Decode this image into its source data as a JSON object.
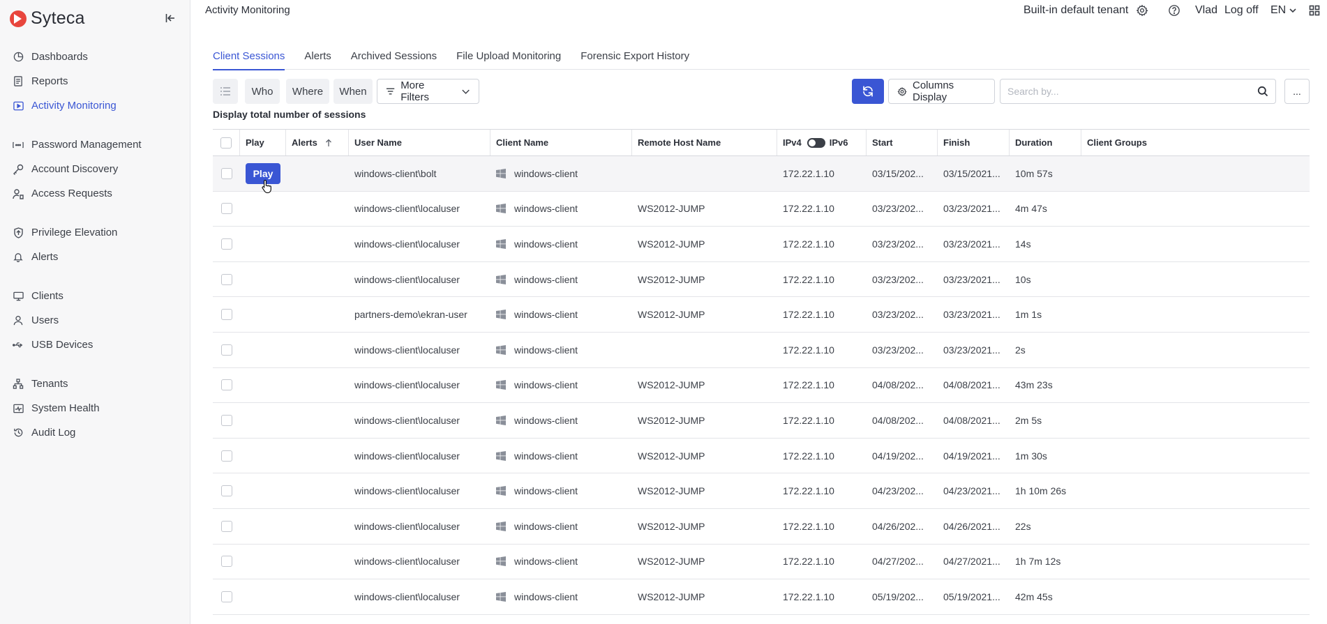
{
  "brand": {
    "name": "Syteca"
  },
  "sidebar": {
    "groups": [
      [
        {
          "label": "Dashboards",
          "icon": "dashboard-icon",
          "active": false
        },
        {
          "label": "Reports",
          "icon": "report-icon",
          "active": false
        },
        {
          "label": "Activity Monitoring",
          "icon": "play-screen-icon",
          "active": true
        }
      ],
      [
        {
          "label": "Password Management",
          "icon": "password-icon",
          "active": false
        },
        {
          "label": "Account Discovery",
          "icon": "key-icon",
          "active": false
        },
        {
          "label": "Access Requests",
          "icon": "access-request-icon",
          "active": false
        }
      ],
      [
        {
          "label": "Privilege Elevation",
          "icon": "shield-up-icon",
          "active": false
        },
        {
          "label": "Alerts",
          "icon": "bell-icon",
          "active": false
        }
      ],
      [
        {
          "label": "Clients",
          "icon": "monitor-icon",
          "active": false
        },
        {
          "label": "Users",
          "icon": "user-icon",
          "active": false
        },
        {
          "label": "USB Devices",
          "icon": "usb-icon",
          "active": false
        }
      ],
      [
        {
          "label": "Tenants",
          "icon": "tenants-icon",
          "active": false
        },
        {
          "label": "System Health",
          "icon": "health-icon",
          "active": false
        },
        {
          "label": "Audit Log",
          "icon": "history-icon",
          "active": false
        }
      ]
    ]
  },
  "header": {
    "title": "Activity Monitoring",
    "tenant": "Built-in default tenant",
    "user": "Vlad",
    "logoff": "Log off",
    "language": "EN"
  },
  "tabs": [
    {
      "label": "Client Sessions",
      "active": true
    },
    {
      "label": "Alerts",
      "active": false
    },
    {
      "label": "Archived Sessions",
      "active": false
    },
    {
      "label": "File Upload Monitoring",
      "active": false
    },
    {
      "label": "Forensic Export History",
      "active": false
    }
  ],
  "toolbar": {
    "who": "Who",
    "where": "Where",
    "when": "When",
    "more_filters": "More Filters",
    "columns_display": "Columns Display",
    "search_placeholder": "Search by...",
    "more": "..."
  },
  "total_label": "Display total number of sessions",
  "table": {
    "columns": [
      "Play",
      "Alerts",
      "User Name",
      "Client Name",
      "Remote Host Name",
      "IPv4",
      "IPv6",
      "Start",
      "Finish",
      "Duration",
      "Client Groups"
    ],
    "play_label": "Play",
    "rows": [
      {
        "user": "windows-client\\bolt",
        "client": "windows-client",
        "remote": "",
        "ip": "172.22.1.10",
        "start": "03/15/202...",
        "finish": "03/15/2021...",
        "duration": "10m 57s",
        "play": true
      },
      {
        "user": "windows-client\\localuser",
        "client": "windows-client",
        "remote": "WS2012-JUMP",
        "ip": "172.22.1.10",
        "start": "03/23/202...",
        "finish": "03/23/2021...",
        "duration": "4m 47s"
      },
      {
        "user": "windows-client\\localuser",
        "client": "windows-client",
        "remote": "WS2012-JUMP",
        "ip": "172.22.1.10",
        "start": "03/23/202...",
        "finish": "03/23/2021...",
        "duration": "14s"
      },
      {
        "user": "windows-client\\localuser",
        "client": "windows-client",
        "remote": "WS2012-JUMP",
        "ip": "172.22.1.10",
        "start": "03/23/202...",
        "finish": "03/23/2021...",
        "duration": "10s"
      },
      {
        "user": "partners-demo\\ekran-user",
        "client": "windows-client",
        "remote": "WS2012-JUMP",
        "ip": "172.22.1.10",
        "start": "03/23/202...",
        "finish": "03/23/2021...",
        "duration": "1m 1s"
      },
      {
        "user": "windows-client\\localuser",
        "client": "windows-client",
        "remote": "",
        "ip": "172.22.1.10",
        "start": "03/23/202...",
        "finish": "03/23/2021...",
        "duration": "2s"
      },
      {
        "user": "windows-client\\localuser",
        "client": "windows-client",
        "remote": "WS2012-JUMP",
        "ip": "172.22.1.10",
        "start": "04/08/202...",
        "finish": "04/08/2021...",
        "duration": "43m 23s"
      },
      {
        "user": "windows-client\\localuser",
        "client": "windows-client",
        "remote": "WS2012-JUMP",
        "ip": "172.22.1.10",
        "start": "04/08/202...",
        "finish": "04/08/2021...",
        "duration": "2m 5s"
      },
      {
        "user": "windows-client\\localuser",
        "client": "windows-client",
        "remote": "WS2012-JUMP",
        "ip": "172.22.1.10",
        "start": "04/19/202...",
        "finish": "04/19/2021...",
        "duration": "1m 30s"
      },
      {
        "user": "windows-client\\localuser",
        "client": "windows-client",
        "remote": "WS2012-JUMP",
        "ip": "172.22.1.10",
        "start": "04/23/202...",
        "finish": "04/23/2021...",
        "duration": "1h 10m 26s"
      },
      {
        "user": "windows-client\\localuser",
        "client": "windows-client",
        "remote": "WS2012-JUMP",
        "ip": "172.22.1.10",
        "start": "04/26/202...",
        "finish": "04/26/2021...",
        "duration": "22s"
      },
      {
        "user": "windows-client\\localuser",
        "client": "windows-client",
        "remote": "WS2012-JUMP",
        "ip": "172.22.1.10",
        "start": "04/27/202...",
        "finish": "04/27/2021...",
        "duration": "1h 7m 12s"
      },
      {
        "user": "windows-client\\localuser",
        "client": "windows-client",
        "remote": "WS2012-JUMP",
        "ip": "172.22.1.10",
        "start": "05/19/202...",
        "finish": "05/19/2021...",
        "duration": "42m 45s"
      }
    ]
  },
  "colors": {
    "accent": "#3a56d4",
    "brand_red": "#e8463d"
  }
}
